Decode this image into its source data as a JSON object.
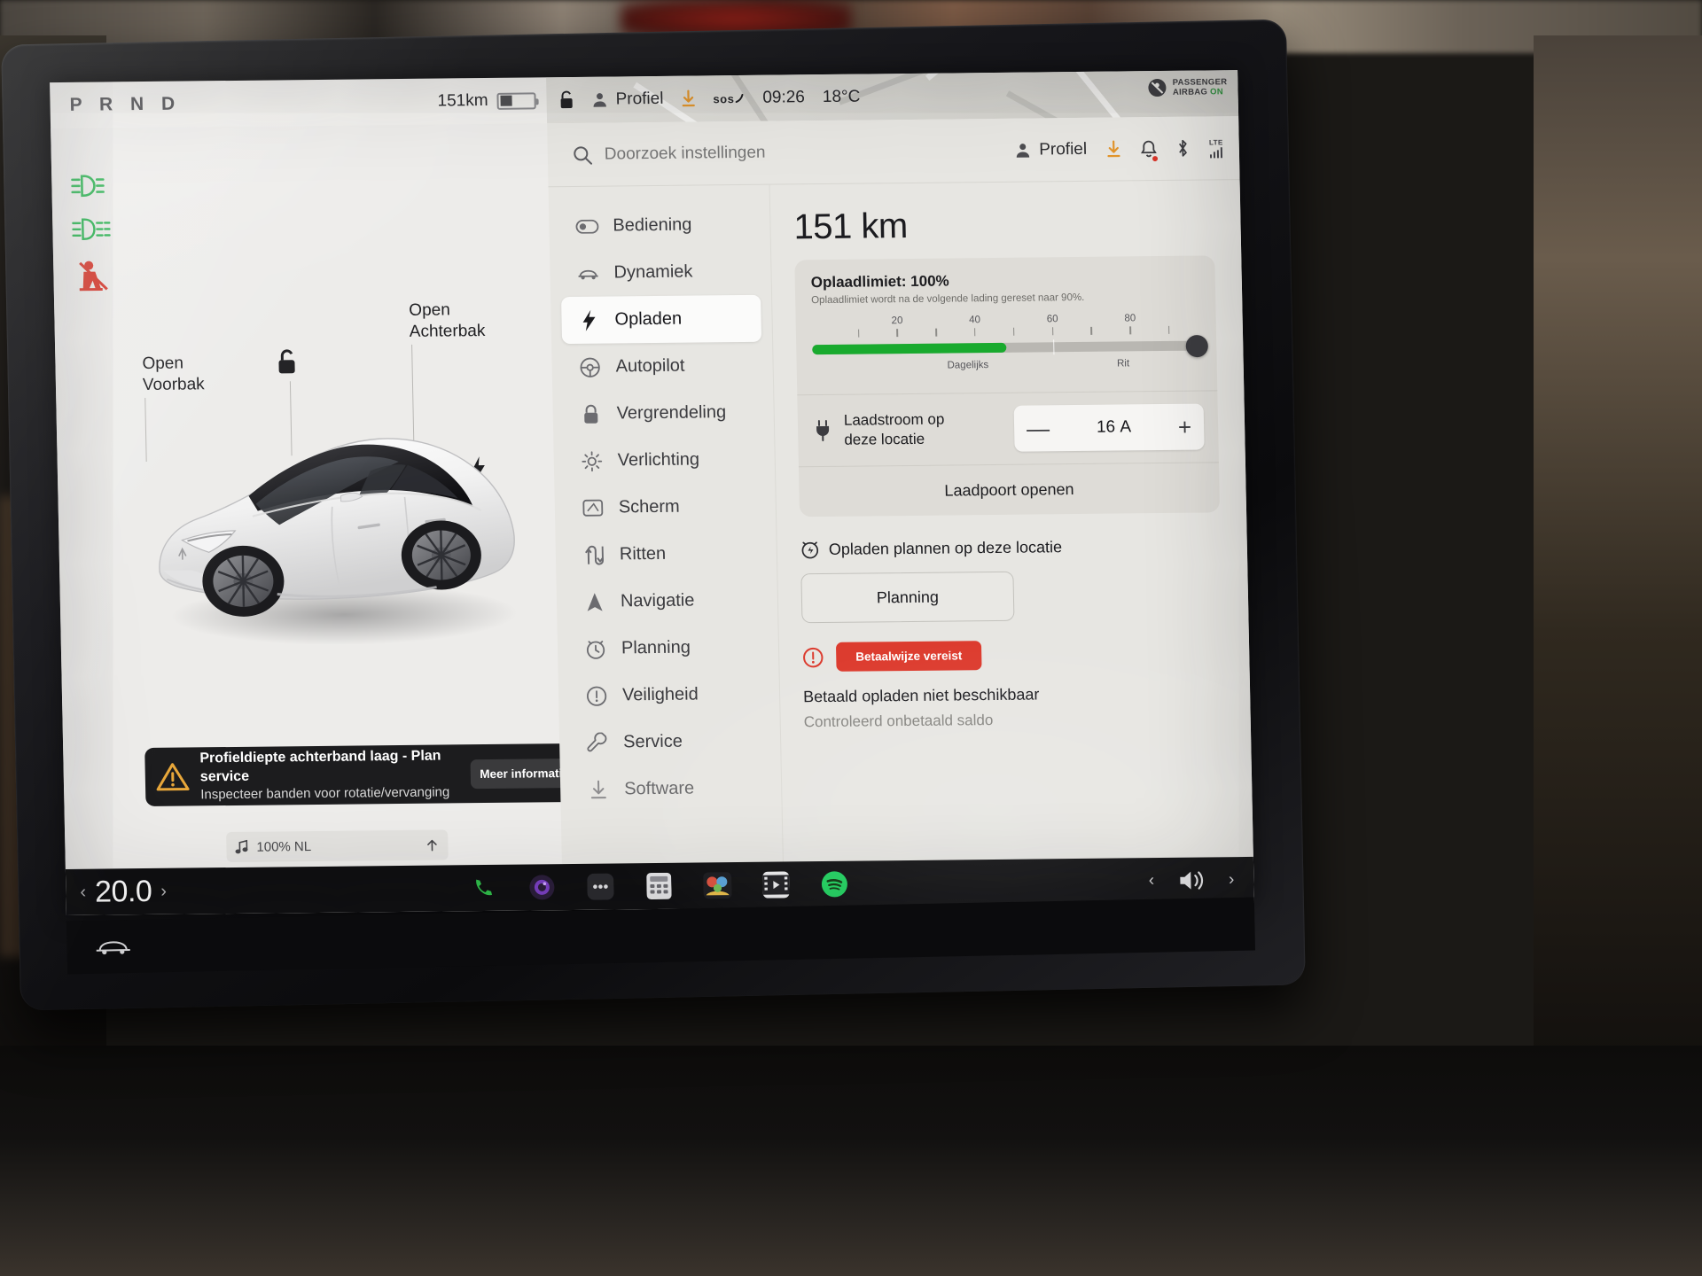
{
  "status_bar": {
    "gear_indicator": "P R N D",
    "range": "151km",
    "profile_label": "Profiel",
    "sos_label": "sos",
    "clock": "09:26",
    "temperature": "18°C",
    "passenger_airbag_line1": "PASSENGER",
    "passenger_airbag_line2": "AIRBAG",
    "passenger_airbag_state": "ON"
  },
  "car_panel": {
    "tell_tales": [
      "headlight-beam-icon",
      "fog-light-icon",
      "seatbelt-warning-icon"
    ],
    "callouts": [
      {
        "line1": "Open",
        "line2": "Voorbak"
      },
      {
        "line1": "Open",
        "line2": "Achterbak"
      }
    ],
    "notification": {
      "title": "Profieldiepte achterband laag - Plan service",
      "subtitle": "Inspecteer banden voor rotatie/vervanging",
      "button": "Meer informatie"
    },
    "media": {
      "label": "100% NL",
      "note_icon": "music-note-icon",
      "expand_icon": "arrow-up-icon"
    }
  },
  "settings": {
    "search": {
      "placeholder": "Doorzoek instellingen",
      "value": ""
    },
    "toolbar": {
      "profile_label": "Profiel",
      "download_icon": "download-icon",
      "bell_icon": "bell-icon",
      "bluetooth_icon": "bluetooth-icon",
      "signal_label": "LTE"
    },
    "menu": [
      {
        "label": "Bediening",
        "icon": "toggle-icon",
        "active": false
      },
      {
        "label": "Dynamiek",
        "icon": "car-icon",
        "active": false
      },
      {
        "label": "Opladen",
        "icon": "bolt-icon",
        "active": true
      },
      {
        "label": "Autopilot",
        "icon": "steering-icon",
        "active": false
      },
      {
        "label": "Vergrendeling",
        "icon": "lock-icon",
        "active": false
      },
      {
        "label": "Verlichting",
        "icon": "sun-icon",
        "active": false
      },
      {
        "label": "Scherm",
        "icon": "display-icon",
        "active": false
      },
      {
        "label": "Ritten",
        "icon": "route-icon",
        "active": false
      },
      {
        "label": "Navigatie",
        "icon": "navigation-icon",
        "active": false
      },
      {
        "label": "Planning",
        "icon": "clock-icon",
        "active": false
      },
      {
        "label": "Veiligheid",
        "icon": "alert-icon",
        "active": false
      },
      {
        "label": "Service",
        "icon": "wrench-icon",
        "active": false
      },
      {
        "label": "Software",
        "icon": "download-icon",
        "active": false
      }
    ],
    "charging": {
      "range_value": "151 km",
      "limit_title": "Oplaadlimiet: 100%",
      "limit_note": "Oplaadlimiet wordt na de volgende lading gereset naar 90%.",
      "slider": {
        "percent": 100,
        "fill_percent": 50,
        "knob_percent": 100,
        "daily_label": "Dagelijks",
        "trip_label": "Rit",
        "tick_numbers": [
          "20",
          "40",
          "60",
          "80"
        ]
      },
      "amp_label_line1": "Laadstroom op",
      "amp_label_line2": "deze locatie",
      "amp_value": "16",
      "amp_unit": "A",
      "amp_minus": "—",
      "amp_plus": "+",
      "charge_port_button": "Laadpoort openen",
      "schedule_header": "Opladen plannen op deze locatie",
      "schedule_button": "Planning",
      "payment_badge": "Betaalwijze vereist",
      "payment_line1": "Betaald opladen niet beschikbaar",
      "payment_line2": "Controleerd onbetaald saldo"
    }
  },
  "dock": {
    "temperature": "20.0",
    "left_chevron": "‹",
    "right_chevron": "›",
    "apps": [
      {
        "name": "phone-app-icon",
        "glyph": "phone"
      },
      {
        "name": "camera-app-icon",
        "glyph": "camera"
      },
      {
        "name": "more-apps-icon",
        "glyph": "dots"
      },
      {
        "name": "calculator-app-icon",
        "glyph": "calc"
      },
      {
        "name": "theater-app-icon",
        "glyph": "theater"
      },
      {
        "name": "video-app-icon",
        "glyph": "video"
      },
      {
        "name": "spotify-app-icon",
        "glyph": "spotify"
      }
    ],
    "volume_icon": "volume-icon",
    "car_icon": "car-icon"
  },
  "colors": {
    "accent_green": "#19aa2e",
    "alert_red": "#dc3a2d",
    "ui_bg": "#e7e6e2",
    "card_bg": "#dedcd7"
  }
}
